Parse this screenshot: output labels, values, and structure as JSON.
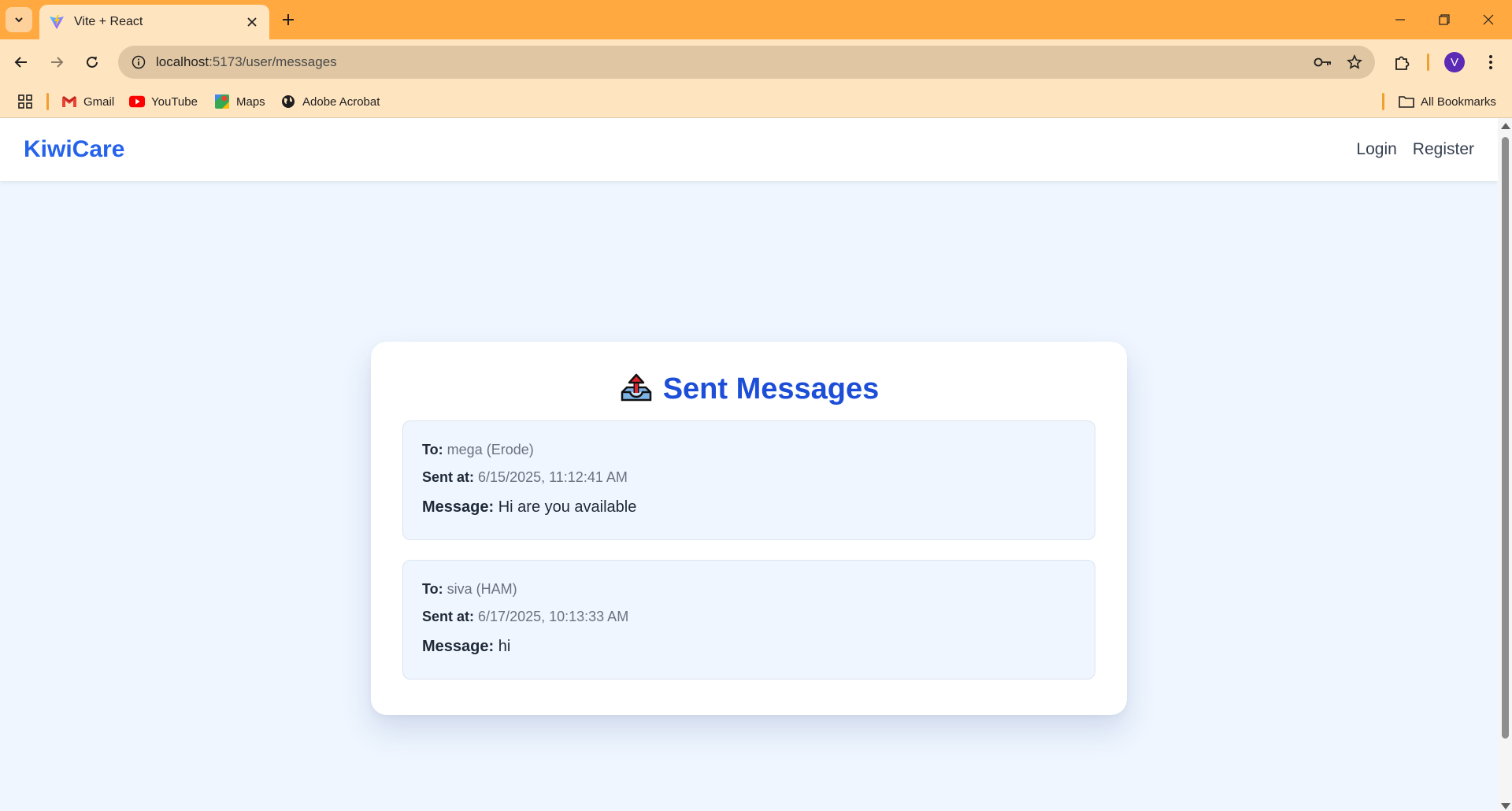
{
  "browser": {
    "tab_title": "Vite + React",
    "url_host": "localhost",
    "url_path": ":5173/user/messages",
    "avatar_letter": "V",
    "bookmarks": [
      "Gmail",
      "YouTube",
      "Maps",
      "Adobe Acrobat"
    ],
    "all_bookmarks_label": "All Bookmarks"
  },
  "header": {
    "brand": "KiwiCare",
    "login_label": "Login",
    "register_label": "Register"
  },
  "page": {
    "title_icon": "outbox-tray-icon",
    "title": "Sent Messages",
    "labels": {
      "to": "To:",
      "sent_at": "Sent at:",
      "message": "Message:"
    },
    "messages": [
      {
        "to": "mega (Erode)",
        "sent_at": "6/15/2025, 11:12:41 AM",
        "message": "Hi are you available"
      },
      {
        "to": "siva (HAM)",
        "sent_at": "6/17/2025, 10:13:33 AM",
        "message": "hi"
      }
    ]
  },
  "colors": {
    "brand": "#2563eb",
    "title": "#1d4ed8",
    "page_bg": "#eff6ff",
    "browser_accent": "#ffa940"
  }
}
